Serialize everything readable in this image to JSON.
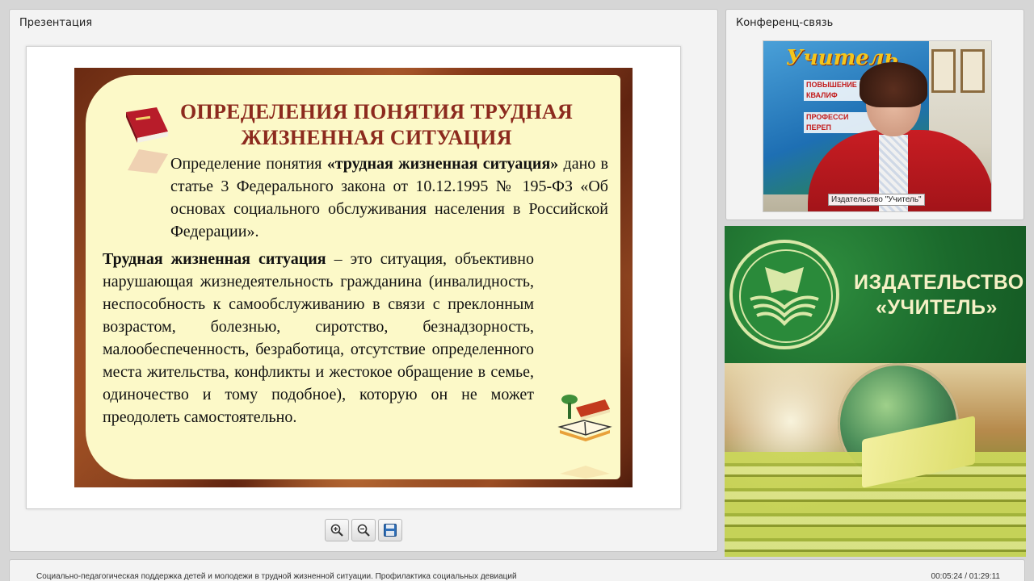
{
  "presentation": {
    "panel_title": "Презентация",
    "slide": {
      "title_line1": "ОПРЕДЕЛЕНИЯ ПОНЯТИЯ ТРУДНАЯ",
      "title_line2": "ЖИЗНЕННАЯ СИТУАЦИЯ",
      "para1_part1": "Определение понятия ",
      "para1_bold": "«трудная жизненная ситуация»",
      "para1_part2": " дано в статье 3 Федерального закона от 10.12.1995 № 195-ФЗ «Об основах социального обслуживания населения в Российской Федерации».",
      "para2_bold": "Трудная жизненная ситуация",
      "para2_text": " – это ситуация, объективно нарушающая жизнедеятельность гражданина (инвалидность, неспособность к самообслуживанию в связи с преклонным возрастом, болезнью, сиротство, безнадзорность, малообеспеченность, безработица, отсутствие определенного места жительства, конфликты и жестокое обращение в семье, одиночество и тому подобное), которую он не может преодолеть самостоятельно."
    },
    "toolbar": {
      "zoom_in_icon": "zoom-in-icon",
      "zoom_out_icon": "zoom-out-icon",
      "save_icon": "save-icon"
    }
  },
  "conference": {
    "panel_title": "Конференц-связь",
    "banner_text": "Учитель",
    "banner_items": [
      "ПОВЫШЕНИЕ КВАЛИФ",
      "ПРОФЕССИ ПЕРЕП"
    ],
    "video_caption": "Издательство \"Учитель\""
  },
  "promo": {
    "name_line1": "ИЗДАТЕЛЬСТВО",
    "name_line2": "«УЧИТЕЛЬ»"
  },
  "footer": {
    "title": "Социально-педагогическая поддержка детей и молодежи в трудной жизненной ситуации. Профилактика социальных девиаций",
    "time": "00:05:24 / 01:29:11"
  },
  "colors": {
    "slide_title": "#8c2a1e",
    "slide_card": "#fcf9c8",
    "promo_green": "#1b6a2c",
    "promo_text": "#f6f1c6"
  }
}
